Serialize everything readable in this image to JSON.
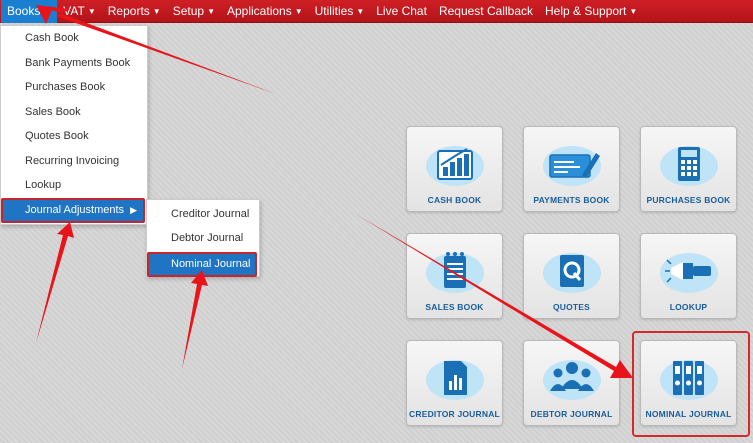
{
  "navbar": {
    "items": [
      {
        "label": "Books",
        "active": true
      },
      {
        "label": "VAT"
      },
      {
        "label": "Reports"
      },
      {
        "label": "Setup"
      },
      {
        "label": "Applications"
      },
      {
        "label": "Utilities"
      },
      {
        "label": "Live Chat"
      },
      {
        "label": "Request Callback"
      },
      {
        "label": "Help & Support"
      }
    ]
  },
  "books_menu": {
    "items": [
      {
        "label": "Cash Book"
      },
      {
        "label": "Bank Payments Book"
      },
      {
        "label": "Purchases Book"
      },
      {
        "label": "Sales Book"
      },
      {
        "label": "Quotes Book"
      },
      {
        "label": "Recurring Invoicing"
      },
      {
        "label": "Lookup"
      },
      {
        "label": "Journal Adjustments",
        "highlighted": true
      }
    ]
  },
  "journal_submenu": {
    "items": [
      {
        "label": "Creditor Journal"
      },
      {
        "label": "Debtor Journal"
      },
      {
        "label": "Nominal Journal",
        "highlighted": true
      }
    ]
  },
  "tiles": [
    {
      "label": "CASH BOOK",
      "icon": "chart-growth-icon"
    },
    {
      "label": "PAYMENTS BOOK",
      "icon": "cheque-pen-icon"
    },
    {
      "label": "PURCHASES BOOK",
      "icon": "calculator-icon"
    },
    {
      "label": "SALES BOOK",
      "icon": "notepad-icon"
    },
    {
      "label": "QUOTES",
      "icon": "quote-document-icon"
    },
    {
      "label": "LOOKUP",
      "icon": "flashlight-icon"
    },
    {
      "label": "CREDITOR JOURNAL",
      "icon": "bar-document-icon"
    },
    {
      "label": "DEBTOR JOURNAL",
      "icon": "people-group-icon"
    },
    {
      "label": "NOMINAL JOURNAL",
      "icon": "binders-icon",
      "highlighted": true
    }
  ],
  "colors": {
    "navbar": "#c4181e",
    "active_nav": "#1a7fd0",
    "menu_highlight": "#1f74c4",
    "annotation": "#e8141a",
    "tile_label": "#1a5d9a"
  }
}
